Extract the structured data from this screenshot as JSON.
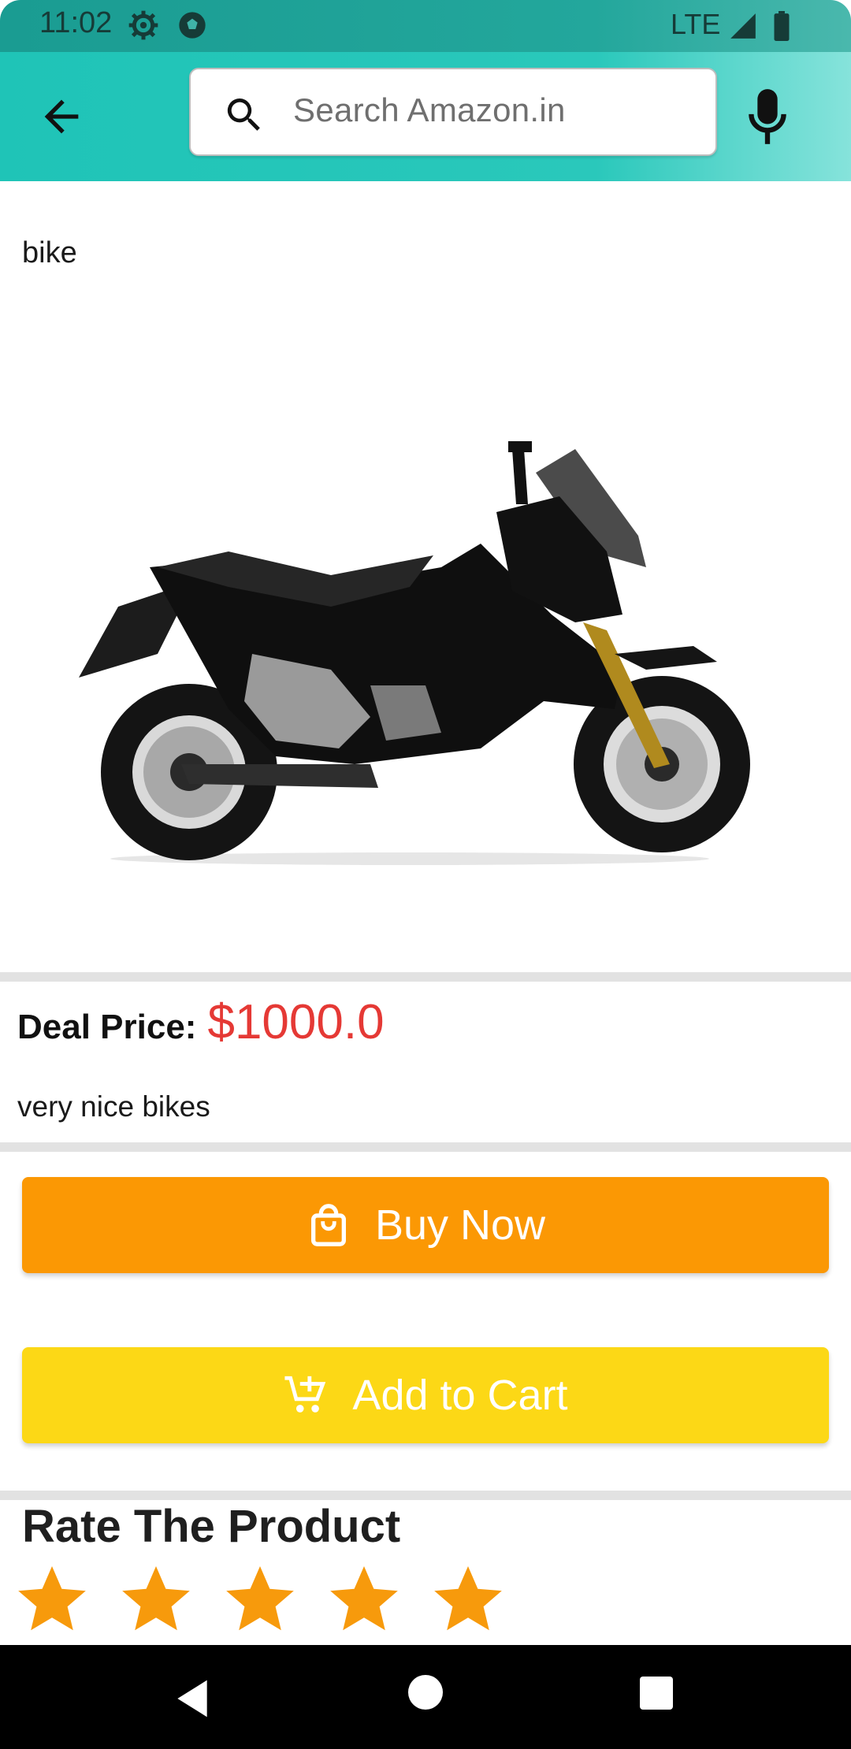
{
  "status_bar": {
    "time": "11:02",
    "network": "LTE",
    "icons": [
      "settings-icon",
      "soccer-ball-icon",
      "signal-icon",
      "battery-icon"
    ]
  },
  "app_bar": {
    "search_placeholder": "Search Amazon.in",
    "icons": [
      "back-arrow-icon",
      "search-icon",
      "mic-icon"
    ],
    "gradient_colors": [
      "#1fc4b7",
      "#86e3db"
    ]
  },
  "product": {
    "title": "bike",
    "image": "black adventure scooter motorcycle photo",
    "price_label": "Deal Price:",
    "price": "$1000.0",
    "description": "very nice bikes"
  },
  "actions": {
    "buy_now": {
      "label": "Buy Now",
      "icon": "shopping-bag-icon",
      "color": "#fb9804"
    },
    "add_to_cart": {
      "label": "Add to Cart",
      "icon": "add-cart-icon",
      "color": "#fcd816"
    }
  },
  "rating": {
    "title": "Rate The Product",
    "stars": 5,
    "star_color": "#f79a0c"
  },
  "nav_bar": {
    "icons": [
      "nav-back-icon",
      "nav-home-icon",
      "nav-recents-icon"
    ]
  }
}
